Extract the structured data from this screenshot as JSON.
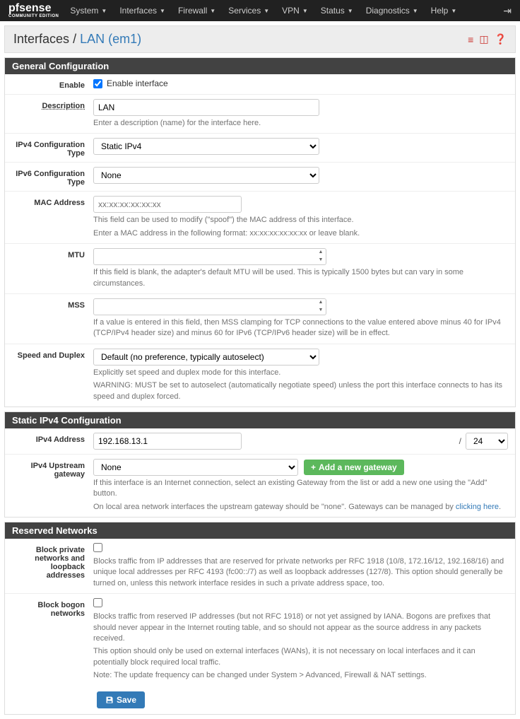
{
  "logo": {
    "main": "pfsense",
    "sub": "COMMUNITY EDITION"
  },
  "nav": {
    "items": [
      "System",
      "Interfaces",
      "Firewall",
      "Services",
      "VPN",
      "Status",
      "Diagnostics",
      "Help"
    ]
  },
  "breadcrumb": {
    "root": "Interfaces",
    "sep": "/",
    "active": "LAN (em1)"
  },
  "sections": {
    "general": {
      "title": "General Configuration",
      "enable": {
        "label": "Enable",
        "text": "Enable interface",
        "checked": true
      },
      "description": {
        "label": "Description",
        "value": "LAN",
        "help": "Enter a description (name) for the interface here."
      },
      "ipv4type": {
        "label": "IPv4 Configuration Type",
        "value": "Static IPv4"
      },
      "ipv6type": {
        "label": "IPv6 Configuration Type",
        "value": "None"
      },
      "mac": {
        "label": "MAC Address",
        "placeholder": "xx:xx:xx:xx:xx:xx",
        "help1": "This field can be used to modify (\"spoof\") the MAC address of this interface.",
        "help2": "Enter a MAC address in the following format: xx:xx:xx:xx:xx:xx or leave blank."
      },
      "mtu": {
        "label": "MTU",
        "help": "If this field is blank, the adapter's default MTU will be used. This is typically 1500 bytes but can vary in some circumstances."
      },
      "mss": {
        "label": "MSS",
        "help": "If a value is entered in this field, then MSS clamping for TCP connections to the value entered above minus 40 for IPv4 (TCP/IPv4 header size) and minus 60 for IPv6 (TCP/IPv6 header size) will be in effect."
      },
      "speed": {
        "label": "Speed and Duplex",
        "value": "Default (no preference, typically autoselect)",
        "help1": "Explicitly set speed and duplex mode for this interface.",
        "help2": "WARNING: MUST be set to autoselect (automatically negotiate speed) unless the port this interface connects to has its speed and duplex forced."
      }
    },
    "static": {
      "title": "Static IPv4 Configuration",
      "ipv4addr": {
        "label": "IPv4 Address",
        "value": "192.168.13.1",
        "slash": "/",
        "mask": "24"
      },
      "gateway": {
        "label": "IPv4 Upstream gateway",
        "value": "None",
        "addbtn": "Add a new gateway",
        "help1": "If this interface is an Internet connection, select an existing Gateway from the list or add a new one using the \"Add\" button.",
        "help2a": "On local area network interfaces the upstream gateway should be \"none\". Gateways can be managed by ",
        "help2link": "clicking here",
        "help2b": "."
      }
    },
    "reserved": {
      "title": "Reserved Networks",
      "private": {
        "label": "Block private networks and loopback addresses",
        "help": "Blocks traffic from IP addresses that are reserved for private networks per RFC 1918 (10/8, 172.16/12, 192.168/16) and unique local addresses per RFC 4193 (fc00::/7) as well as loopback addresses (127/8). This option should generally be turned on, unless this network interface resides in such a private address space, too."
      },
      "bogon": {
        "label": "Block bogon networks",
        "help1": "Blocks traffic from reserved IP addresses (but not RFC 1918) or not yet assigned by IANA. Bogons are prefixes that should never appear in the Internet routing table, and so should not appear as the source address in any packets received.",
        "help2": "This option should only be used on external interfaces (WANs), it is not necessary on local interfaces and it can potentially block required local traffic.",
        "help3": "Note: The update frequency can be changed under System > Advanced, Firewall & NAT settings."
      }
    }
  },
  "save": "Save"
}
